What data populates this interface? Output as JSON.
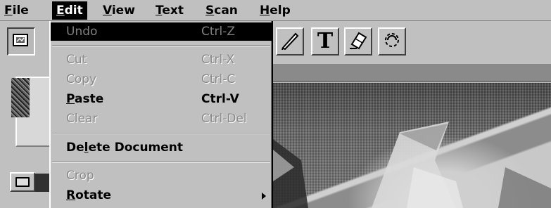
{
  "menubar": {
    "items": [
      {
        "label": "File",
        "accel": "F",
        "rest": "ile"
      },
      {
        "label": "Edit",
        "accel": "E",
        "rest": "dit"
      },
      {
        "label": "View",
        "accel": "V",
        "rest": "iew"
      },
      {
        "label": "Text",
        "accel": "T",
        "rest": "ext"
      },
      {
        "label": "Scan",
        "accel": "S",
        "rest": "can"
      },
      {
        "label": "Help",
        "accel": "H",
        "rest": "elp"
      }
    ]
  },
  "edit_menu": {
    "undo": {
      "label": "Undo",
      "shortcut": "Ctrl-Z",
      "state": "disabled-highlighted"
    },
    "cut": {
      "label": "Cut",
      "shortcut": "Ctrl-X",
      "state": "disabled"
    },
    "copy": {
      "label": "Copy",
      "shortcut": "Ctrl-C",
      "state": "disabled"
    },
    "paste": {
      "label": "Paste",
      "accel": "P",
      "rest": "aste",
      "shortcut": "Ctrl-V",
      "state": "enabled"
    },
    "clear": {
      "label": "Clear",
      "shortcut": "Ctrl-Del",
      "state": "disabled"
    },
    "delete_document": {
      "label": "Delete Document",
      "pre": "De",
      "accel": "l",
      "rest": "ete Document",
      "state": "enabled"
    },
    "crop": {
      "label": "Crop",
      "state": "disabled"
    },
    "rotate": {
      "label": "Rotate",
      "accel": "R",
      "rest": "otate",
      "state": "enabled",
      "submenu": true
    }
  },
  "toolbar": {
    "text_tool_glyph": "T",
    "icons": [
      "scanner-icon",
      "pen-icon",
      "text-icon",
      "eraser-icon",
      "lasso-icon"
    ]
  },
  "colors": {
    "menu_bg": "#c0c0c0",
    "highlight": "#000000",
    "disabled_text": "#8a8a8a"
  }
}
